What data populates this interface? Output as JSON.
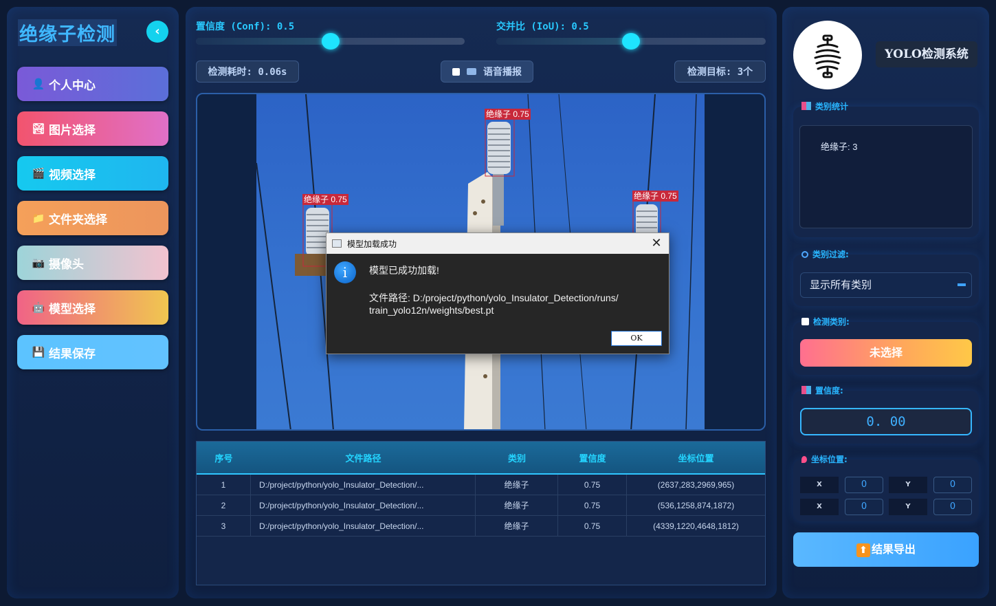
{
  "sidebar": {
    "title": "绝缘子检测",
    "collapse_icon": "‹",
    "items": [
      {
        "label": "个人中心",
        "icon": "user-icon",
        "glyph": "👤",
        "bg": "linear-gradient(90deg,#7a5ad8,#5b6fd9)"
      },
      {
        "label": "图片选择",
        "icon": "image-icon",
        "glyph": "🏞",
        "bg": "linear-gradient(90deg,#f2546e,#e070c8)"
      },
      {
        "label": "视频选择",
        "icon": "film-icon",
        "glyph": "🎬",
        "bg": "linear-gradient(90deg,#16c9ef,#1fb6ef)"
      },
      {
        "label": "文件夹选择",
        "icon": "folder-icon",
        "glyph": "📁",
        "bg": "linear-gradient(90deg,#f5a05a,#ec955c)"
      },
      {
        "label": "摄像头",
        "icon": "webcam-icon",
        "glyph": "📷",
        "bg": "linear-gradient(90deg,#9dd4d9,#f2c2cf)"
      },
      {
        "label": "模型选择",
        "icon": "robot-icon",
        "glyph": "🤖",
        "bg": "linear-gradient(90deg,#f06386,#f0c650)"
      },
      {
        "label": "结果保存",
        "icon": "floppy-icon",
        "glyph": "💾",
        "bg": "linear-gradient(90deg,#5cc3ff,#62c2ff)"
      }
    ]
  },
  "controls": {
    "conf_label": "置信度 (Conf): 0.5",
    "conf_value": 0.5,
    "iou_label": "交并比 (IoU): 0.5",
    "iou_value": 0.5,
    "time_label": "检测耗时: 0.06s",
    "voice_label": "语音播报",
    "targets_label": "检测目标: 3个"
  },
  "detections_overlay": [
    {
      "label": "绝缘子 0.75"
    },
    {
      "label": "绝缘子 0.75"
    },
    {
      "label": "绝缘子 0.75"
    }
  ],
  "dialog": {
    "title": "模型加载成功",
    "info_icon": "i",
    "message": "模型已成功加载!",
    "path_line1": "文件路径: D:/project/python/yolo_Insulator_Detection/runs/",
    "path_line2": "train_yolo12n/weights/best.pt",
    "ok_label": "OK",
    "close_glyph": "✕"
  },
  "table": {
    "headers": [
      "序号",
      "文件路径",
      "类别",
      "置信度",
      "坐标位置"
    ],
    "rows": [
      {
        "index": "1",
        "path": "D:/project/python/yolo_Insulator_Detection/...",
        "category": "绝缘子",
        "conf": "0.75",
        "coords": "(2637,283,2969,965)"
      },
      {
        "index": "2",
        "path": "D:/project/python/yolo_Insulator_Detection/...",
        "category": "绝缘子",
        "conf": "0.75",
        "coords": "(536,1258,874,1872)"
      },
      {
        "index": "3",
        "path": "D:/project/python/yolo_Insulator_Detection/...",
        "category": "绝缘子",
        "conf": "0.75",
        "coords": "(4339,1220,4648,1812)"
      }
    ]
  },
  "right": {
    "system_title": "YOLO检测系统",
    "stats_title": "类别统计",
    "stats_text": "绝缘子: 3",
    "filter_title": "类别过滤:",
    "filter_value": "显示所有类别",
    "detect_class_title": "检测类别:",
    "not_selected": "未选择",
    "conf_title": "置信度:",
    "conf_value": "0. 00",
    "coord_title": "坐标位置:",
    "coords": {
      "x1": "0",
      "y1": "0",
      "x2": "0",
      "y2": "0"
    },
    "coord_x_label": "X",
    "coord_y_label": "Y",
    "export_label": "结果导出",
    "export_icon": "⬆"
  }
}
